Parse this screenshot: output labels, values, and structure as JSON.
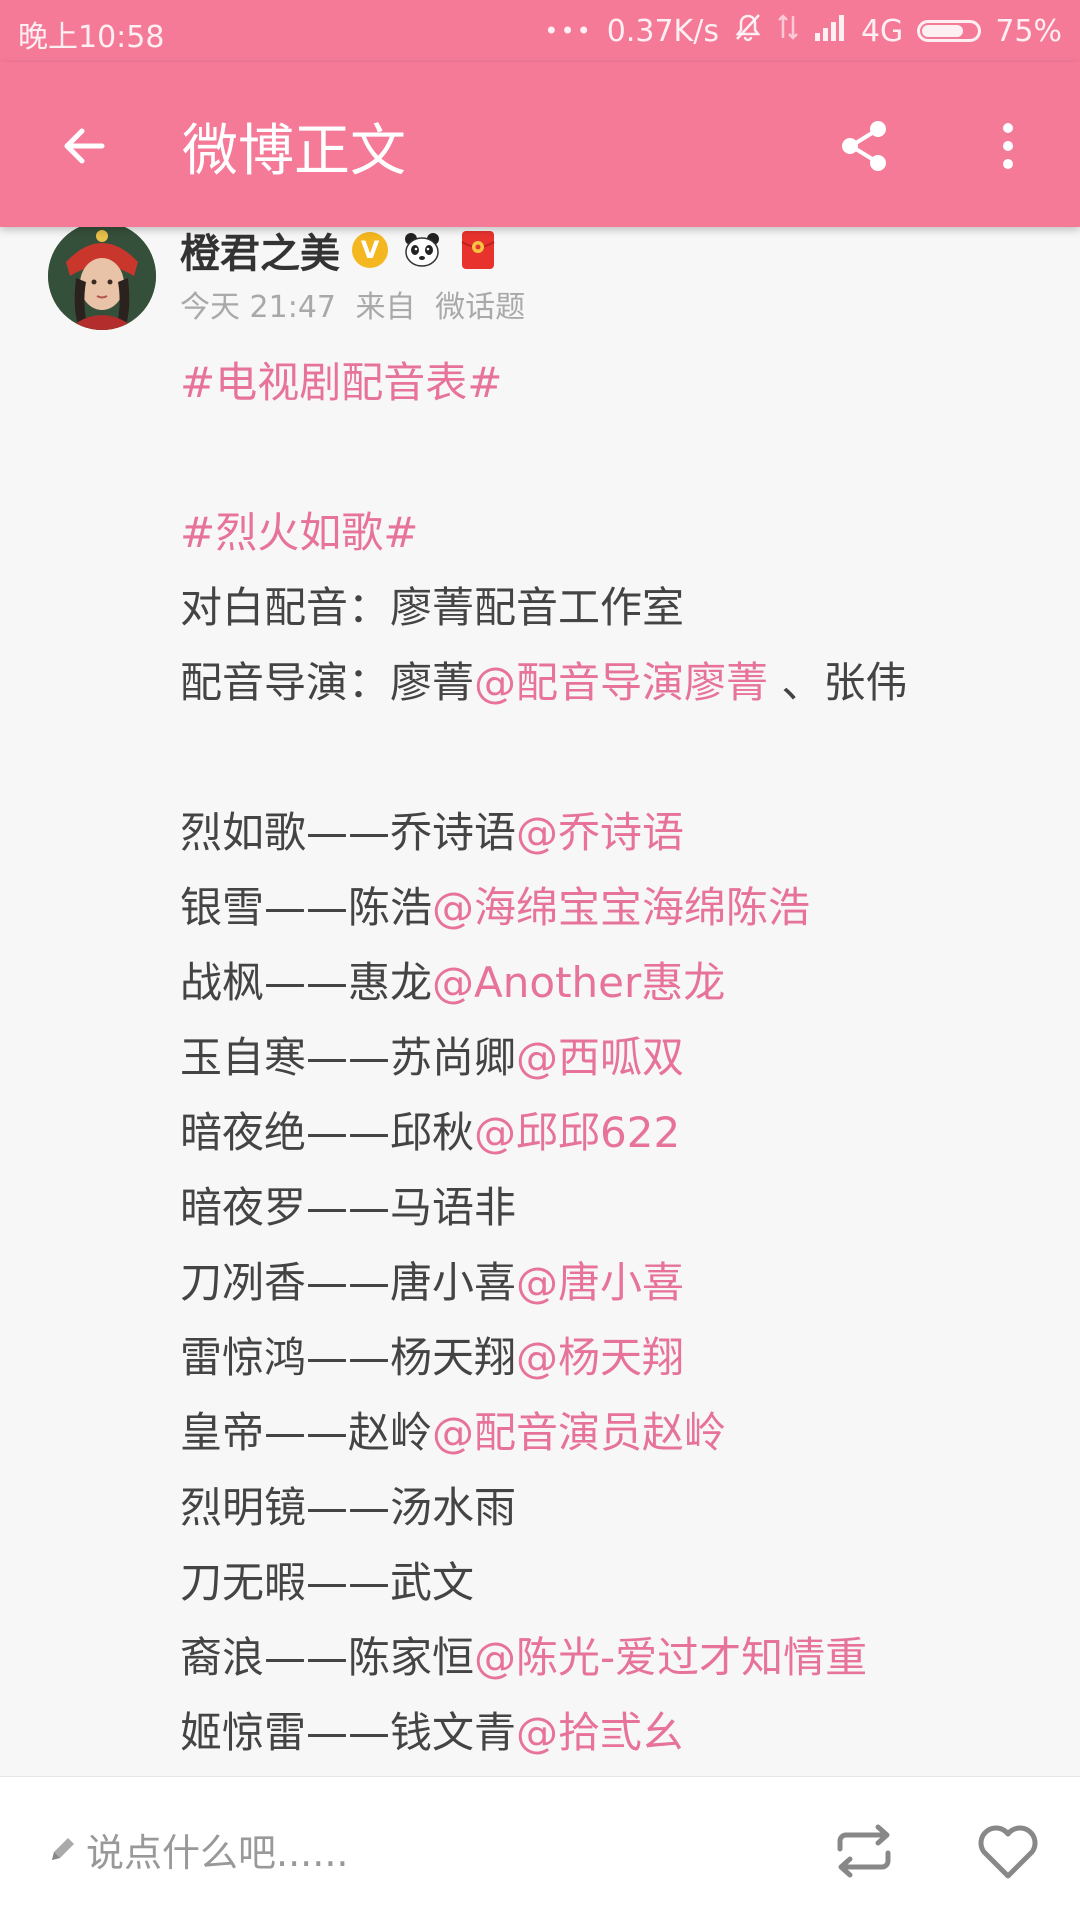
{
  "status_bar": {
    "time": "晚上10:58",
    "network_speed": "0.37K/s",
    "network_type": "4G",
    "battery": "75%",
    "battery_level": 0.75,
    "icons": [
      "more-dots-icon",
      "mute-bell-icon",
      "data-arrows-icon",
      "signal-icon",
      "battery-icon"
    ]
  },
  "toolbar": {
    "title": "微博正文",
    "icons": [
      "back-arrow-icon",
      "share-icon",
      "more-vertical-icon"
    ]
  },
  "post": {
    "username": "橙君之美",
    "verified_mark": "V",
    "badges": [
      "verified-icon",
      "panda-icon",
      "red-packet-icon"
    ],
    "time": "今天 21:47",
    "source_prefix": "来自",
    "source": "微话题",
    "lines": [
      [
        {
          "text": "#电视剧配音表#",
          "link": true
        }
      ],
      [],
      [
        {
          "text": "#烈火如歌#",
          "link": true
        }
      ],
      [
        {
          "text": "对白配音：廖菁配音工作室",
          "link": false
        }
      ],
      [
        {
          "text": "配音导演：廖菁",
          "link": false
        },
        {
          "text": "@配音导演廖菁",
          "link": true
        },
        {
          "text": " 、张伟",
          "link": false
        }
      ],
      [],
      [
        {
          "text": "烈如歌——乔诗语",
          "link": false
        },
        {
          "text": "@乔诗语",
          "link": true
        }
      ],
      [
        {
          "text": "银雪——陈浩",
          "link": false
        },
        {
          "text": "@海绵宝宝海绵陈浩",
          "link": true
        }
      ],
      [
        {
          "text": "战枫——惠龙",
          "link": false
        },
        {
          "text": "@Another惠龙",
          "link": true
        }
      ],
      [
        {
          "text": "玉自寒——苏尚卿",
          "link": false
        },
        {
          "text": "@西呱双",
          "link": true
        }
      ],
      [
        {
          "text": "暗夜绝——邱秋",
          "link": false
        },
        {
          "text": "@邱邱622",
          "link": true
        }
      ],
      [
        {
          "text": "暗夜罗——马语非",
          "link": false
        }
      ],
      [
        {
          "text": "刀冽香——唐小喜",
          "link": false
        },
        {
          "text": "@唐小喜",
          "link": true
        }
      ],
      [
        {
          "text": "雷惊鸿——杨天翔",
          "link": false
        },
        {
          "text": "@杨天翔",
          "link": true
        }
      ],
      [
        {
          "text": "皇帝——赵岭",
          "link": false
        },
        {
          "text": "@配音演员赵岭",
          "link": true
        }
      ],
      [
        {
          "text": "烈明镜——汤水雨",
          "link": false
        }
      ],
      [
        {
          "text": "刀无暇——武文",
          "link": false
        }
      ],
      [
        {
          "text": "裔浪——陈家恒",
          "link": false
        },
        {
          "text": "@陈光-爱过才知情重",
          "link": true
        }
      ],
      [
        {
          "text": "姬惊雷——钱文青",
          "link": false
        },
        {
          "text": "@拾弎幺",
          "link": true
        }
      ]
    ]
  },
  "bottom_bar": {
    "comment_placeholder": "说点什么吧......",
    "icons": [
      "pencil-icon",
      "repost-icon",
      "like-heart-icon"
    ]
  },
  "colors": {
    "primary_pink": "#f47a98",
    "link_pink": "#e7739a",
    "body_text": "#444444",
    "meta_text": "#a9a9a9",
    "verified_gold": "#f5b71f"
  }
}
